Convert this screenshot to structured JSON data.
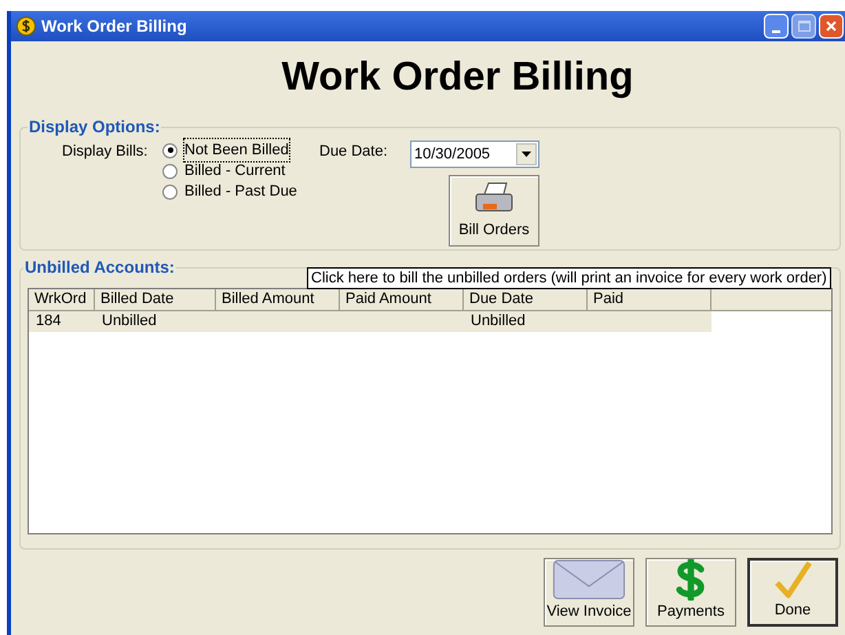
{
  "window": {
    "title": "Work Order Billing"
  },
  "heading": "Work Order Billing",
  "display_options": {
    "title": "Display Options:",
    "display_bills_label": "Display Bills:",
    "options": [
      {
        "label": "Not Been Billed",
        "selected": true
      },
      {
        "label": "Billed - Current",
        "selected": false
      },
      {
        "label": "Billed - Past Due",
        "selected": false
      }
    ],
    "due_date_label": "Due Date:",
    "due_date": {
      "value": "10/30/2005"
    },
    "bill_orders_button": "Bill Orders"
  },
  "tooltip": "Click here to bill the unbilled orders (will print an invoice for every work order)",
  "unbilled_accounts": {
    "title": "Unbilled Accounts:",
    "columns": [
      "WrkOrd",
      "Billed Date",
      "Billed Amount",
      "Paid Amount",
      "Due Date",
      "Paid"
    ],
    "rows": [
      {
        "wrkord": "184",
        "billed_date": "Unbilled",
        "due_date": "Unbilled"
      }
    ]
  },
  "buttons": [
    {
      "kind": "envelope",
      "label": "View Invoice"
    },
    {
      "kind": "dollar",
      "label": "Payments"
    },
    {
      "kind": "check",
      "label": "Done"
    }
  ]
}
